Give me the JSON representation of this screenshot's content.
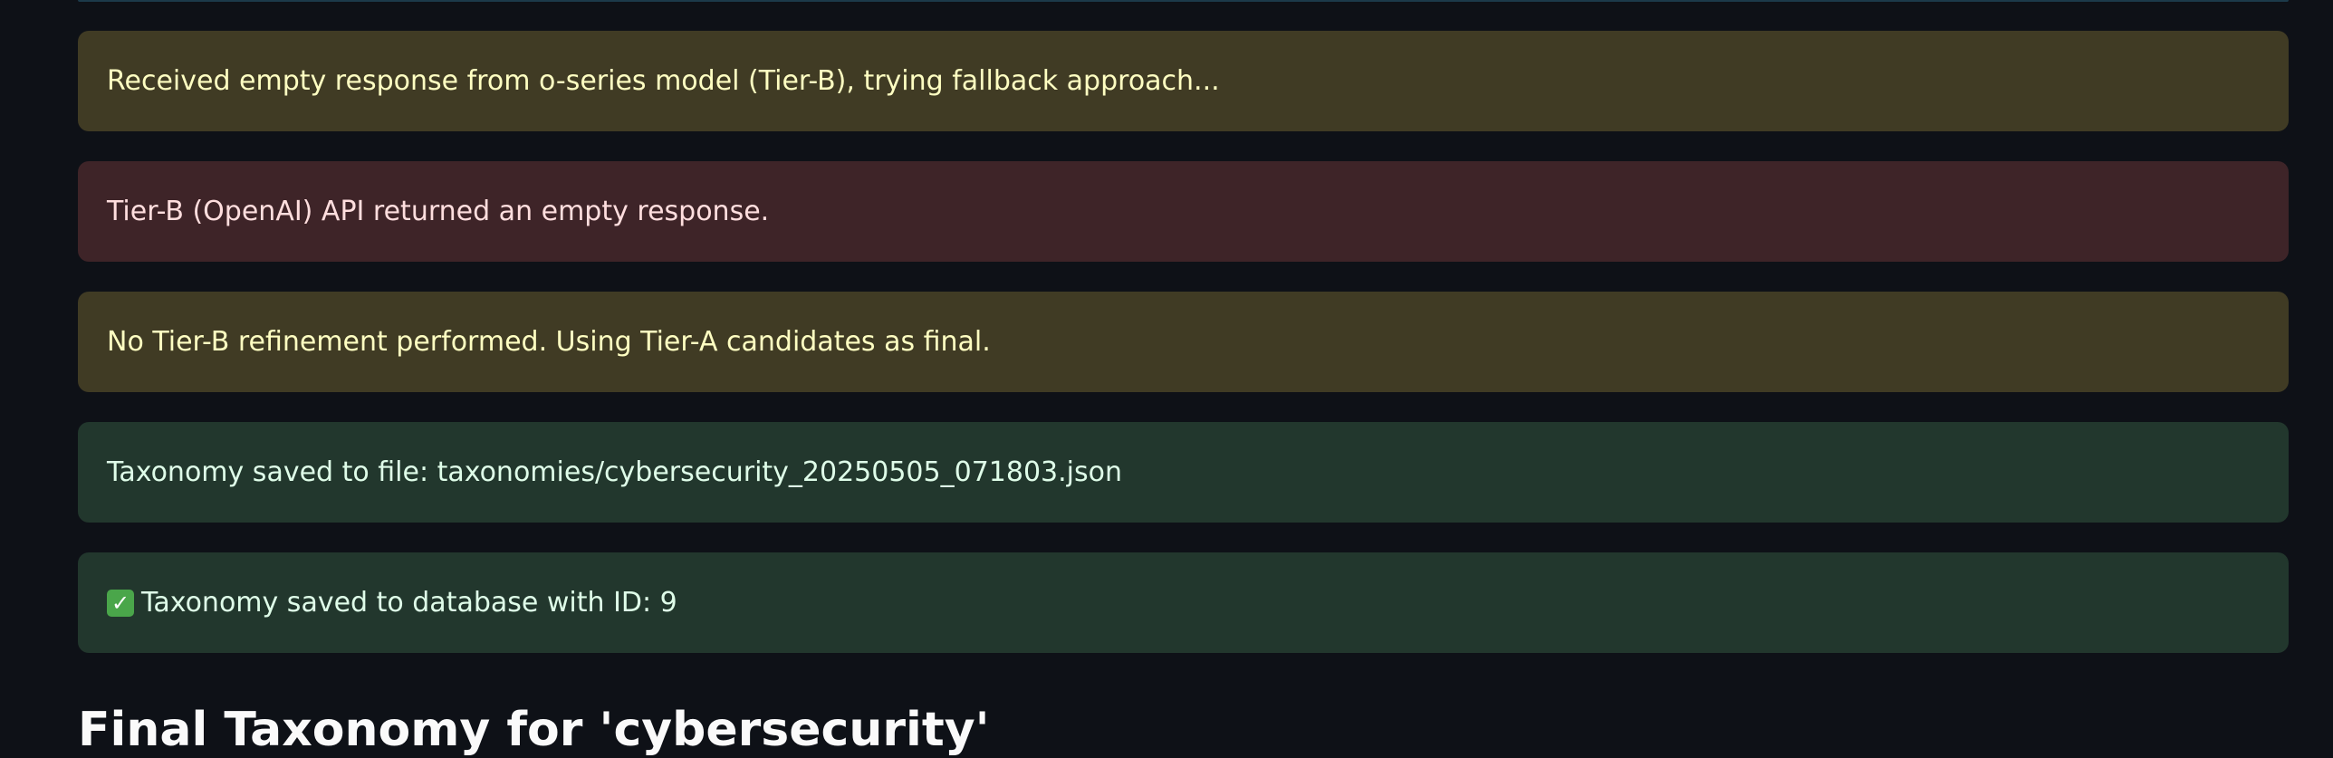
{
  "alerts": [
    {
      "kind": "warning",
      "text": "Received empty response from o-series model (Tier-B), trying fallback approach..."
    },
    {
      "kind": "error",
      "text": "Tier-B (OpenAI) API returned an empty response."
    },
    {
      "kind": "warning",
      "text": "No Tier-B refinement performed. Using Tier-A candidates as final."
    },
    {
      "kind": "success",
      "text": "Taxonomy saved to file: taxonomies/cybersecurity_20250505_071803.json"
    },
    {
      "kind": "success",
      "icon": "check-icon",
      "text": "Taxonomy saved to database with ID: 9"
    }
  ],
  "final_heading": "Final Taxonomy for 'cybersecurity'",
  "colors": {
    "background": "#0e1117",
    "warning_bg": "#403b24",
    "warning_text": "#ffffc2",
    "error_bg": "#3e2428",
    "error_text": "#ffdede",
    "success_bg": "#22372d",
    "success_text": "#dffde9"
  }
}
